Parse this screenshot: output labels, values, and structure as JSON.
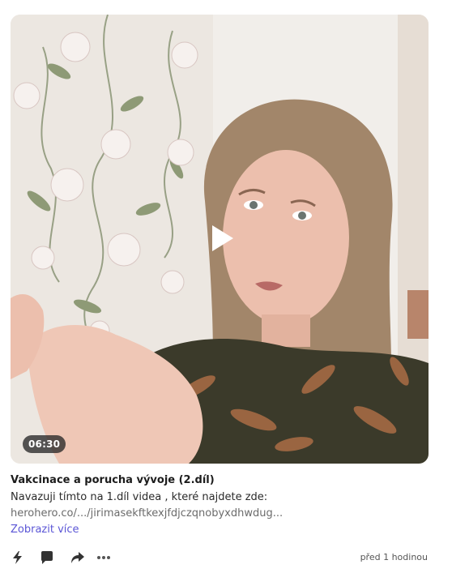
{
  "post": {
    "duration": "06:30",
    "title": "Vakcinace a porucha vývoje (2.díl)",
    "description": "Navazuji tímto na 1.díl videa , které najdete zde:",
    "link_text": "herohero.co/.../jirimasekftkexjfdjczqnobyxdhwdug...",
    "more_label": "Zobrazit více",
    "timestamp": "před 1 hodinou"
  },
  "icons": {
    "play": "play-icon",
    "lightning": "lightning-icon",
    "comment": "comment-icon",
    "share": "share-icon",
    "more": "more-dots-icon"
  },
  "colors": {
    "link_accent": "#5b56d6",
    "duration_badge_bg": "#282828"
  }
}
